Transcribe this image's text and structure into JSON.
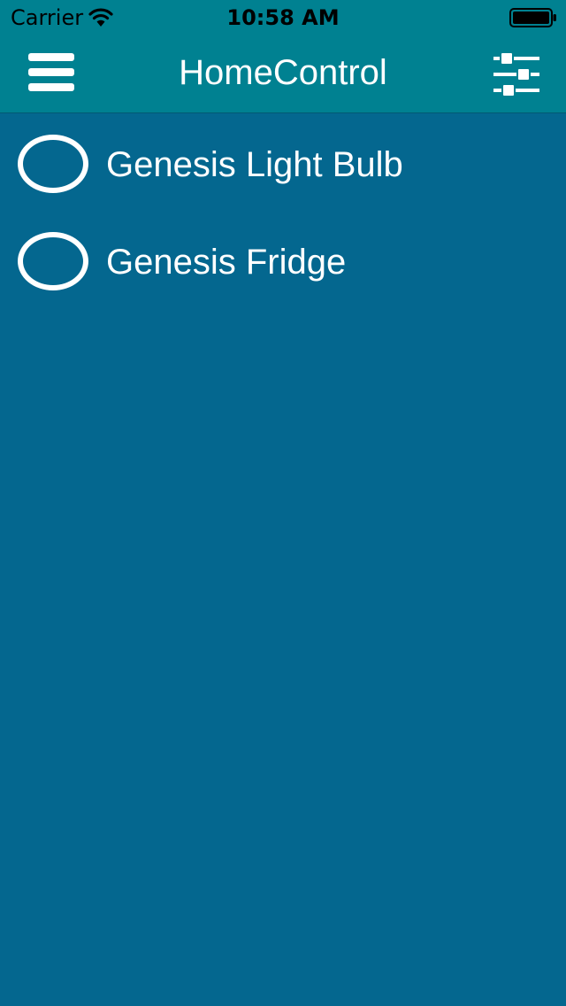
{
  "status_bar": {
    "carrier": "Carrier",
    "time": "10:58 AM",
    "wifi_icon": "wifi-icon",
    "battery_icon": "battery-full-icon"
  },
  "nav_bar": {
    "title": "HomeControl",
    "menu_icon": "hamburger-menu-icon",
    "settings_icon": "sliders-icon"
  },
  "devices": [
    {
      "name": "Genesis Light Bulb",
      "state": "off"
    },
    {
      "name": "Genesis Fridge",
      "state": "off"
    }
  ],
  "colors": {
    "header_bg": "#008191",
    "content_bg": "#04678f",
    "text": "#ffffff"
  }
}
